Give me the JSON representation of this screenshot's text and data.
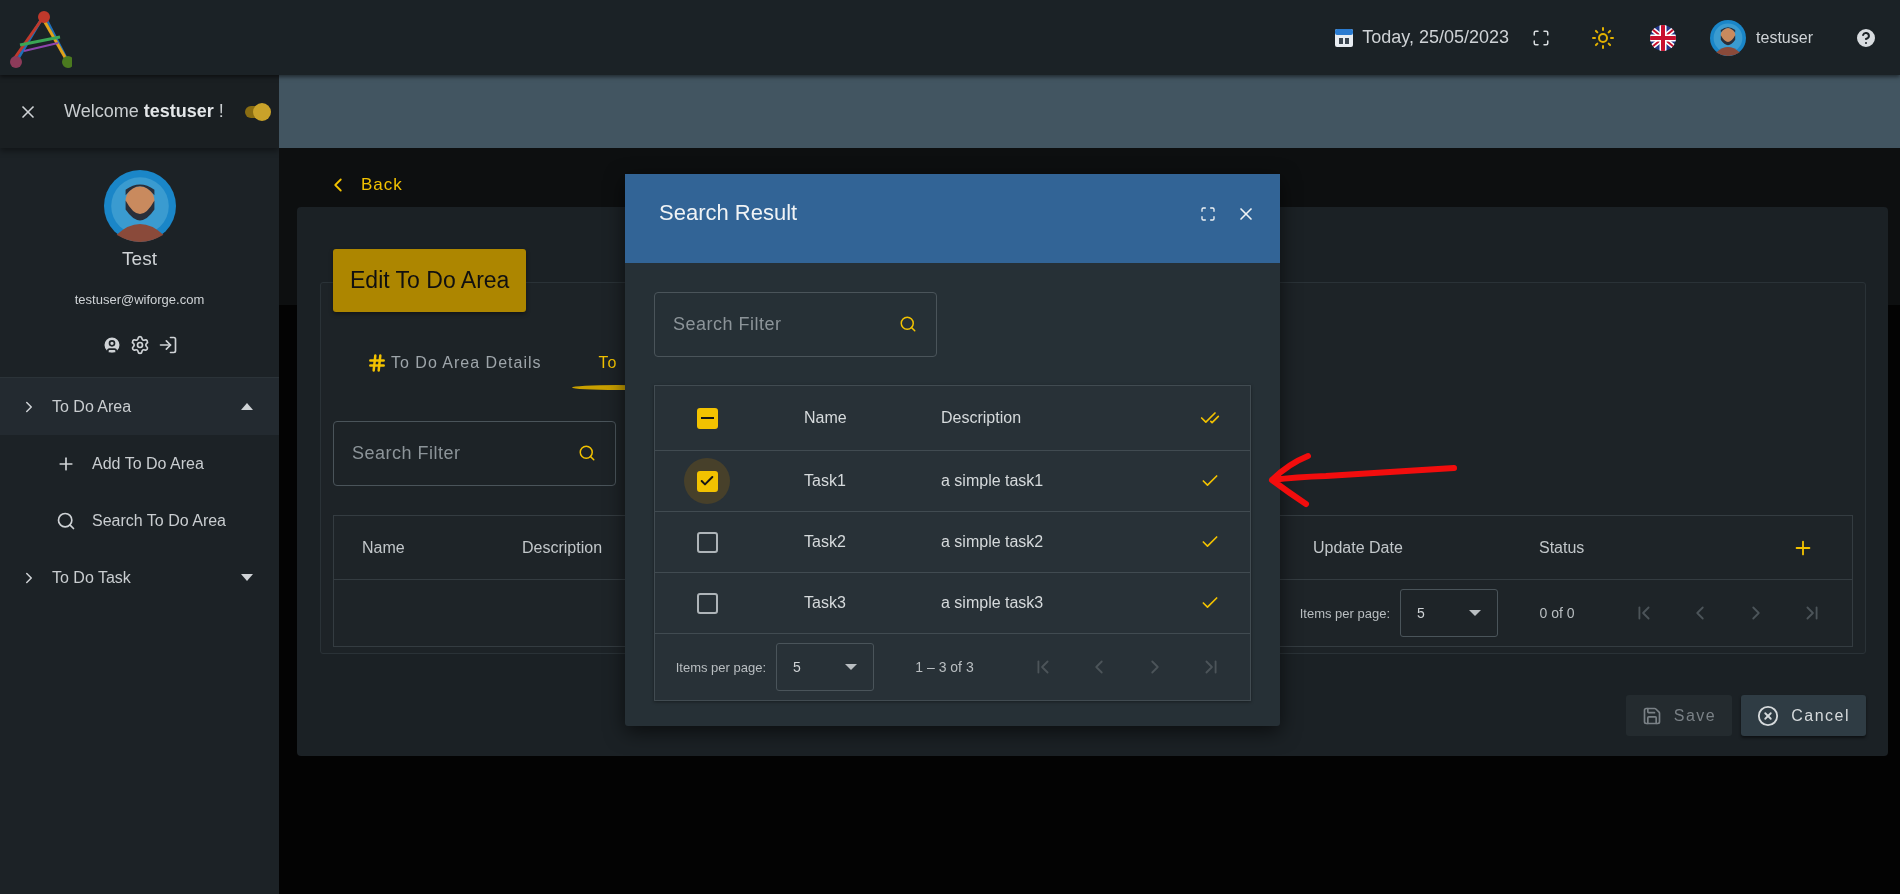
{
  "top_bar": {
    "date": "Today, 25/05/2023",
    "username": "testuser"
  },
  "sidebar": {
    "welcome": "Welcome **testuser** !",
    "theme_toggle": {
      "on": true
    },
    "profile": {
      "name": "Test",
      "email": "testuser@wiforge.com"
    },
    "menu": [
      {
        "label": "To Do Area",
        "expanded": true,
        "children": [
          {
            "label": "Add To Do Area",
            "kind": "add"
          },
          {
            "label": "Search To Do Area",
            "kind": "search"
          }
        ]
      },
      {
        "label": "To Do Task",
        "expanded": false
      }
    ]
  },
  "page": {
    "back": "Back",
    "title": "Edit To Do Area",
    "tabs": [
      {
        "label": "To Do Area Details",
        "selected": false
      },
      {
        "label": "To",
        "selected": true
      }
    ],
    "search": {
      "placeholder": "Search Filter"
    },
    "table": {
      "columns": [
        "Name",
        "Description",
        "Update Date",
        "Status"
      ],
      "items_per_page_label": "Items per page:",
      "items_per_page": "5",
      "range": "0 of 0",
      "nav_disabled": true
    },
    "buttons": [
      {
        "label": "Save",
        "kind": "save",
        "disabled": true
      },
      {
        "label": "Cancel",
        "kind": "cancel",
        "disabled": false
      }
    ]
  },
  "dialog": {
    "title": "Search Result",
    "search": {
      "placeholder": "Search Filter"
    },
    "table": {
      "columns": [
        "Name",
        "Description"
      ],
      "header_checkbox": {
        "indeterminate": true
      },
      "rows": [
        {
          "name": "Task1",
          "description": "a simple task1",
          "checked": true,
          "focused": true
        },
        {
          "name": "Task2",
          "description": "a simple task2",
          "checked": false,
          "focused": false
        },
        {
          "name": "Task3",
          "description": "a simple task3",
          "checked": false,
          "focused": false
        }
      ],
      "items_per_page_label": "Items per page:",
      "items_per_page": "5",
      "range": "1 – 3 of 3",
      "nav_disabled": true
    }
  }
}
